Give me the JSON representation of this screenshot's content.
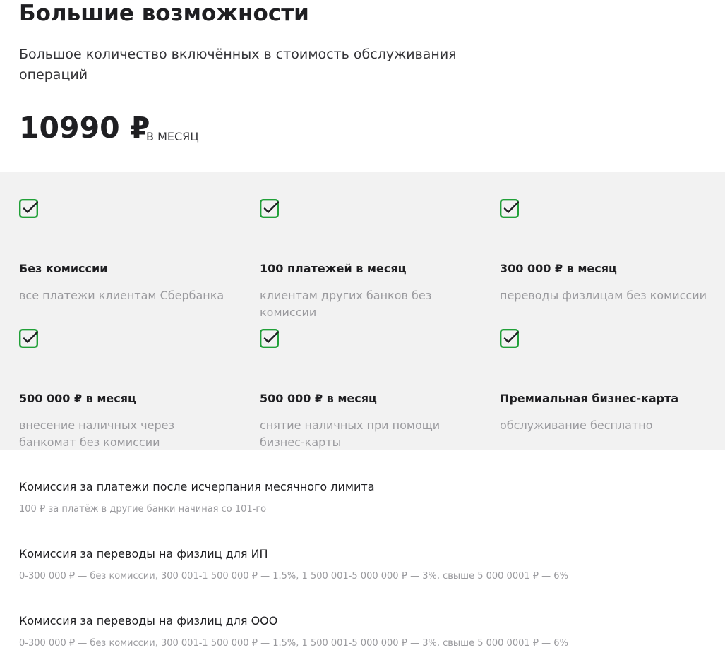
{
  "header": {
    "title": "Большие возможности",
    "subtitle": "Большое количество включённых в стоимость обслуживания операций",
    "price": "10990 ₽",
    "period": "в месяц"
  },
  "features": [
    {
      "icon": "checkbox-checked-icon",
      "title": "Без комиссии",
      "description": "все платежи клиентам Сбербанка"
    },
    {
      "icon": "checkbox-checked-icon",
      "title": "100 платежей в месяц",
      "description": "клиентам других банков без комиссии"
    },
    {
      "icon": "checkbox-checked-icon",
      "title": "300 000 ₽ в месяц",
      "description": "переводы физлицам без комиссии"
    },
    {
      "icon": "checkbox-checked-icon",
      "title": "500 000 ₽ в месяц",
      "description": "внесение наличных через банкомат без комиссии"
    },
    {
      "icon": "checkbox-checked-icon",
      "title": "500 000 ₽ в месяц",
      "description": "снятие наличных при помощи бизнес-карты"
    },
    {
      "icon": "checkbox-checked-icon",
      "title": "Премиальная бизнес-карта",
      "description": "обслуживание бесплатно"
    }
  ],
  "fees": [
    {
      "title": "Комиссия за платежи после исчерпания месячного лимита",
      "description": "100 ₽ за платёж в другие банки начиная со 101-го"
    },
    {
      "title": "Комиссия за переводы на физлиц для ИП",
      "description": "0-300 000 ₽ — без комиссии, 300 001-1 500 000 ₽ — 1.5%, 1 500 001-5 000 000 ₽ — 3%, свыше 5 000 0001 ₽ — 6%"
    },
    {
      "title": "Комиссия за переводы на физлиц для ООО",
      "description": "0-300 000 ₽ — без комиссии, 300 001-1 500 000 ₽ — 1.5%, 1 500 001-5 000 000 ₽ — 3%, свыше 5 000 0001 ₽ — 6%"
    }
  ],
  "colors": {
    "accent": "#21a038",
    "panel_background": "#f2f2f2",
    "muted_text": "#9a9a9e",
    "primary_text": "#1f1f22"
  }
}
